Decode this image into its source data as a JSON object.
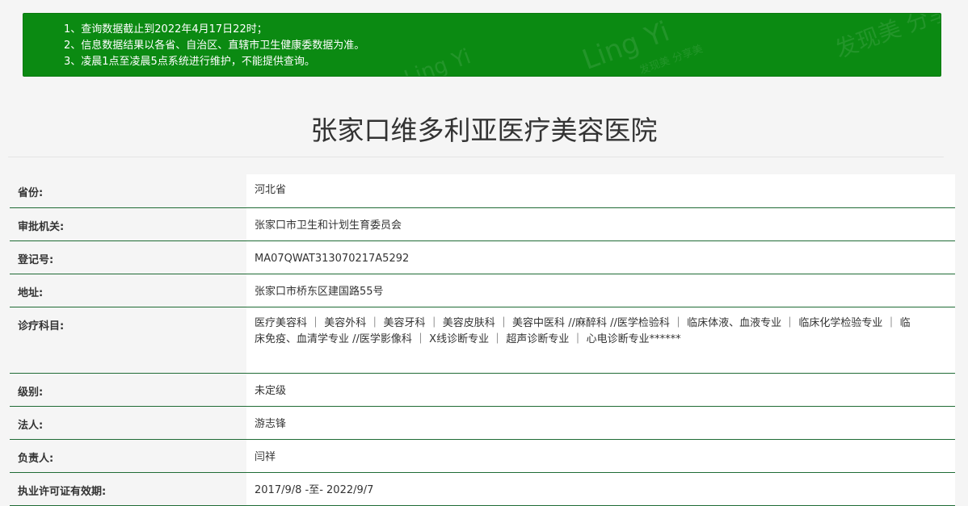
{
  "notice": {
    "items": [
      "1、查询数据截止到2022年4月17日22时；",
      "2、信息数据结果以各省、自治区、直辖市卫生健康委数据为准。",
      "3、凌晨1点至凌晨5点系统进行维护，不能提供查询。"
    ],
    "background_color": "#0b8a12"
  },
  "title": "张家口维多利亚医疗美容医院",
  "rows": [
    {
      "label": "省份:",
      "value": "河北省"
    },
    {
      "label": "审批机关:",
      "value": "张家口市卫生和计划生育委员会"
    },
    {
      "label": "登记号:",
      "value": "MA07QWAT313070217A5292"
    },
    {
      "label": "地址:",
      "value": "张家口市桥东区建国路55号"
    },
    {
      "label": "诊疗科目:",
      "value": "医疗美容科 ｜ 美容外科 ｜ 美容牙科 ｜ 美容皮肤科 ｜ 美容中医科 //麻醉科 //医学检验科 ｜ 临床体液、血液专业 ｜ 临床化学检验专业 ｜ 临床免疫、血清学专业 //医学影像科 ｜ X线诊断专业 ｜ 超声诊断专业 ｜ 心电诊断专业******"
    },
    {
      "label": "级别:",
      "value": "未定级"
    },
    {
      "label": "法人:",
      "value": "游志锋"
    },
    {
      "label": "负责人:",
      "value": "闫祥"
    },
    {
      "label": "执业许可证有效期:",
      "value": "2017/9/8 -至- 2022/9/7"
    }
  ],
  "colors": {
    "notice_bg": "#0b8a12",
    "row_border": "#1f6b35",
    "page_bg": "#f5f5f5"
  }
}
